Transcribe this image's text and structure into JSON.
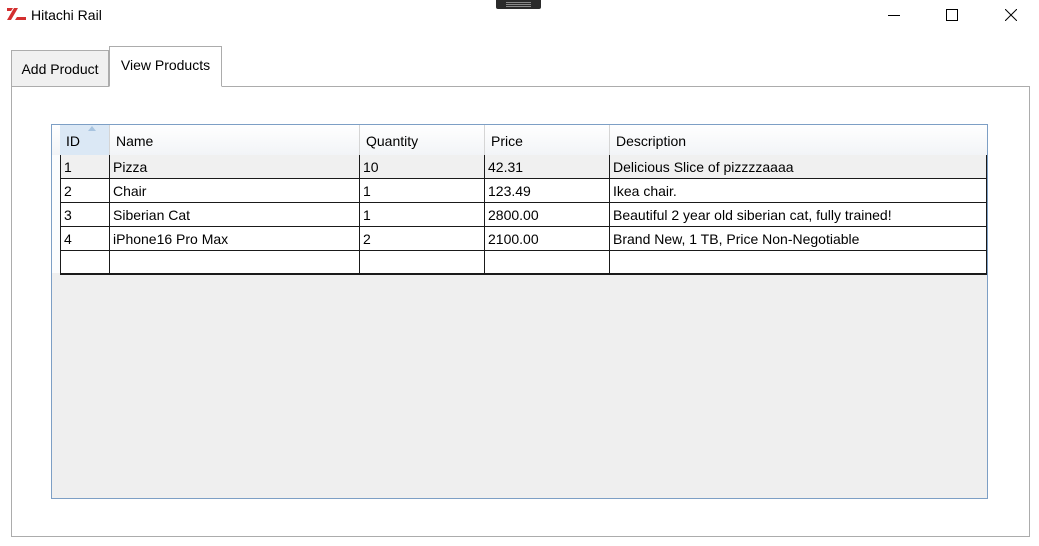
{
  "window": {
    "title": "Hitachi Rail",
    "controls": {
      "minimize": "minimize-icon",
      "maximize": "maximize-icon",
      "close": "close-icon"
    }
  },
  "tabs": [
    {
      "label": "Add Product",
      "selected": false
    },
    {
      "label": "View Products",
      "selected": true
    }
  ],
  "grid": {
    "columns": [
      "ID",
      "Name",
      "Quantity",
      "Price",
      "Description"
    ],
    "sorted_column": "ID",
    "rows": [
      {
        "id": "1",
        "name": "Pizza",
        "quantity": "10",
        "price": "42.31",
        "description": "Delicious Slice of pizzzzaaaa"
      },
      {
        "id": "2",
        "name": "Chair",
        "quantity": "1",
        "price": "123.49",
        "description": "Ikea chair."
      },
      {
        "id": "3",
        "name": "Siberian Cat",
        "quantity": "1",
        "price": "2800.00",
        "description": "Beautiful 2 year old siberian cat, fully trained!"
      },
      {
        "id": "4",
        "name": "iPhone16 Pro Max",
        "quantity": "2",
        "price": "2100.00",
        "description": "Brand New, 1 TB, Price Non-Negotiable"
      }
    ]
  },
  "colors": {
    "logo_red": "#d32f2f",
    "grid_border": "#7d9fc5",
    "grid_background": "#efefef"
  }
}
